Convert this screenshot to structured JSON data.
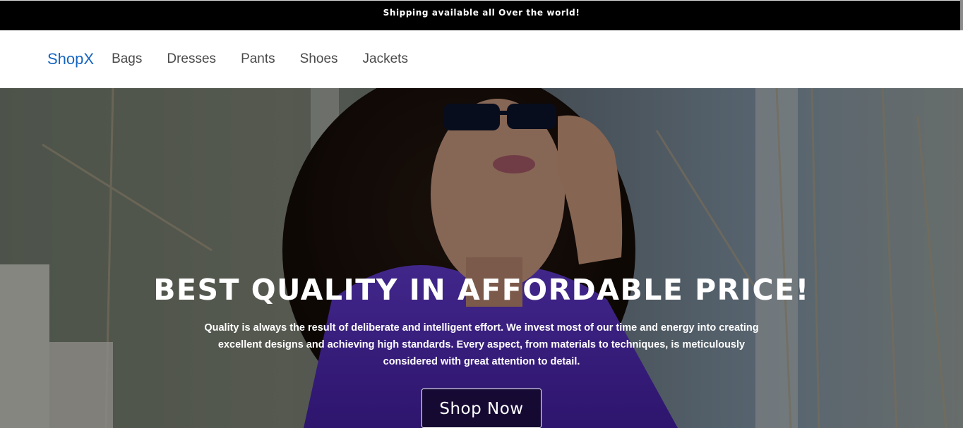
{
  "announcement": {
    "text": "Shipping available all Over the world!"
  },
  "navbar": {
    "brand": "ShopX",
    "links": [
      "Bags",
      "Dresses",
      "Pants",
      "Shoes",
      "Jackets"
    ]
  },
  "hero": {
    "title": "BEST QUALITY IN AFFORDABLE PRICE!",
    "description": "Quality is always the result of deliberate and intelligent effort. We invest most of our time and energy into creating excellent designs and achieving high standards. Every aspect, from materials to techniques, is meticulously considered with great attention to detail.",
    "cta_label": "Shop Now"
  },
  "colors": {
    "brand": "#1565c0",
    "announcement_bg": "#000000",
    "jacket_purple": "#5a2fc2"
  }
}
